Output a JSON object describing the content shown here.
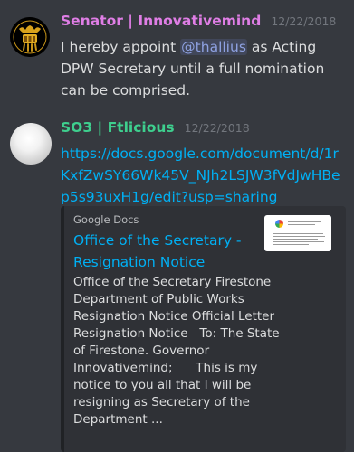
{
  "messages": [
    {
      "username": "Senator | Innovativemind",
      "timestamp": "12/22/2018",
      "text_before": "I hereby appoint ",
      "mention": "@thallius",
      "text_after": " as Acting DPW Secretary until a full nomination can be comprised.",
      "avatar_icon": "seal-icon"
    },
    {
      "username": "SO3 | Ftlicious",
      "timestamp": "12/22/2018",
      "link": "https://docs.google.com/document/d/1rKxfZwSY66Wk45V_NJh2LSJW3fVdJwHBep5s93uxH1g/edit?usp=sharing",
      "avatar_icon": "sphere-icon",
      "embed": {
        "provider": "Google Docs",
        "title": "Office of the Secretary - Resignation Notice",
        "description": "Office of the Secretary Firestone Department of Public Works Resignation Notice Official Letter   Resignation Notice   To: The State of Firestone. Governor Innovativemind;      This is my notice to you all that I will be resigning as Secretary of the Department ...",
        "thumbnail_icon": "document-thumbnail-icon"
      }
    }
  ],
  "colors": {
    "background": "#36393f",
    "embed_background": "#2f3136",
    "link": "#00b0f4",
    "mention": "#8ea1e1",
    "senator_name": "#e07ee6",
    "so3_name": "#3ecf8e"
  }
}
